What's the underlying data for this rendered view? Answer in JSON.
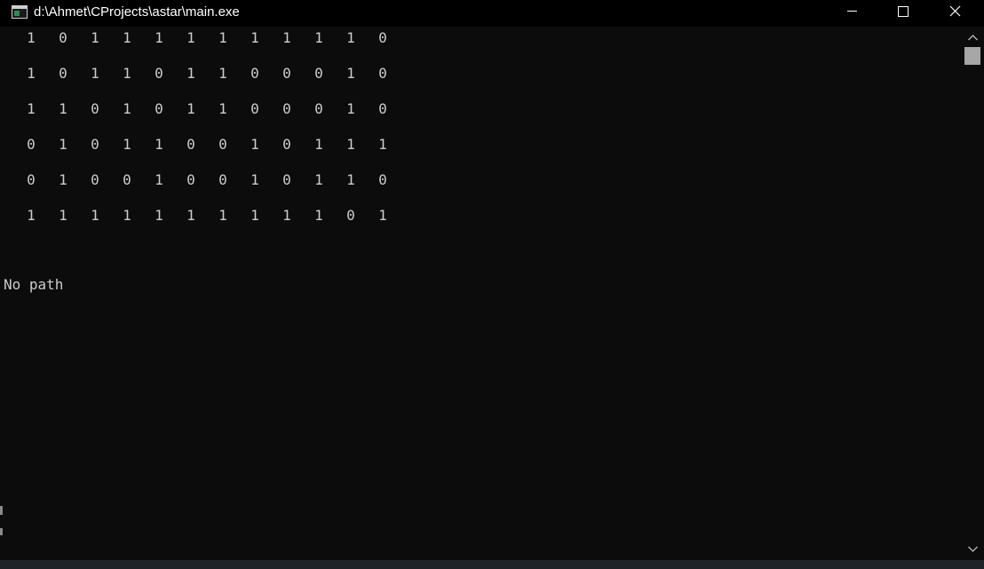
{
  "window": {
    "title": "d:\\Ahmet\\CProjects\\astar\\main.exe"
  },
  "colors": {
    "titlebar_bg": "#000000",
    "console_bg": "#0c0c0c",
    "console_text": "#cccccc",
    "scroll_thumb": "#a6a6a6"
  },
  "icons": {
    "app": "console-window-icon",
    "minimize": "minimize-icon",
    "maximize": "maximize-icon",
    "close": "close-icon",
    "scroll_up": "chevron-up-icon",
    "scroll_down": "chevron-down-icon"
  },
  "console": {
    "grid": [
      [
        "1",
        "0",
        "1",
        "1",
        "1",
        "1",
        "1",
        "1",
        "1",
        "1",
        "1",
        "0"
      ],
      [
        "1",
        "0",
        "1",
        "1",
        "0",
        "1",
        "1",
        "0",
        "0",
        "0",
        "1",
        "0"
      ],
      [
        "1",
        "1",
        "0",
        "1",
        "0",
        "1",
        "1",
        "0",
        "0",
        "0",
        "1",
        "0"
      ],
      [
        "0",
        "1",
        "0",
        "1",
        "1",
        "0",
        "0",
        "1",
        "0",
        "1",
        "1",
        "1"
      ],
      [
        "0",
        "1",
        "0",
        "0",
        "1",
        "0",
        "0",
        "1",
        "0",
        "1",
        "1",
        "0"
      ],
      [
        "1",
        "1",
        "1",
        "1",
        "1",
        "1",
        "1",
        "1",
        "1",
        "1",
        "0",
        "1"
      ]
    ],
    "status": "No path"
  }
}
